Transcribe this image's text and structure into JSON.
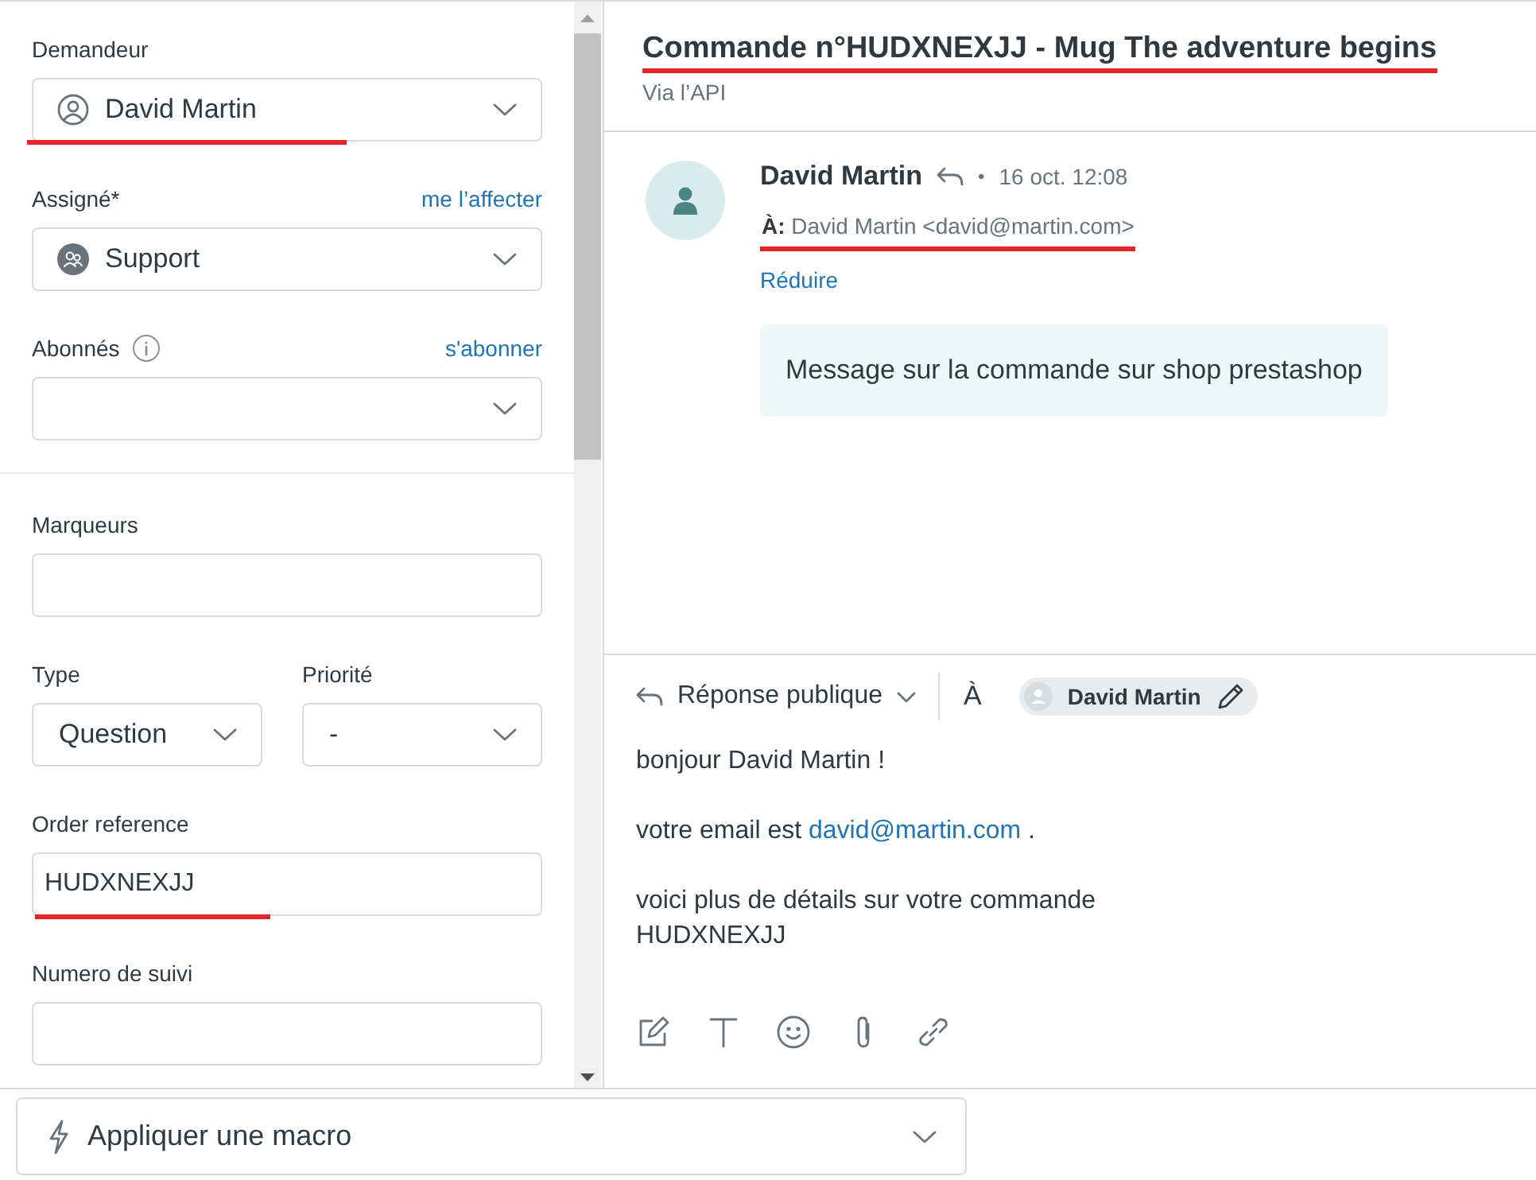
{
  "sidebar": {
    "groups": [
      {
        "fields": [
          {
            "kind": "person_select",
            "label": "Demandeur",
            "value": "David Martin",
            "annotated": true
          },
          {
            "kind": "group_select",
            "label": "Assigné*",
            "link": "me l’affecter",
            "value": "Support"
          },
          {
            "kind": "select",
            "label": "Abonnés",
            "info": true,
            "link": "s'abonner"
          }
        ]
      },
      {
        "fields": [
          {
            "kind": "input",
            "label": "Marqueurs"
          },
          {
            "kind": "pair",
            "fields": [
              {
                "kind": "select",
                "label": "Type",
                "value": "Question"
              },
              {
                "kind": "select",
                "label": "Priorité",
                "value": "-"
              }
            ]
          },
          {
            "kind": "input",
            "label": "Order reference",
            "value": "HUDXNEXJJ",
            "annotated": true
          },
          {
            "kind": "input",
            "label": "Numero de suivi"
          }
        ]
      }
    ],
    "macro_button": "Appliquer une macro"
  },
  "ticket": {
    "title": "Commande n°HUDXNEXJJ - Mug The adventure begins",
    "title_annotated": true,
    "channel": "Via l’API"
  },
  "message": {
    "author": "David Martin",
    "separator": "•",
    "time": "16 oct. 12:08",
    "to_label": "À:",
    "to_value": "David Martin <david@martin.com>",
    "to_annotated": true,
    "collapse": "Réduire",
    "body": "Message sur la commande sur shop prestashop"
  },
  "composer": {
    "mode": "Réponse publique",
    "to_label": "À",
    "recipient": "David Martin",
    "paragraphs": [
      {
        "lines": [
          [
            {
              "kind": "text",
              "text": "bonjour David Martin !"
            }
          ]
        ]
      },
      {
        "lines": [
          [
            {
              "kind": "text",
              "text": "votre email est "
            },
            {
              "kind": "link",
              "text": "david@martin.com"
            },
            {
              "kind": "text",
              "text": " ."
            }
          ]
        ]
      },
      {
        "lines": [
          [
            {
              "kind": "text",
              "text": "voici plus de détails sur votre commande"
            }
          ],
          [
            {
              "kind": "text",
              "text": "HUDXNEXJJ"
            }
          ]
        ]
      }
    ]
  }
}
